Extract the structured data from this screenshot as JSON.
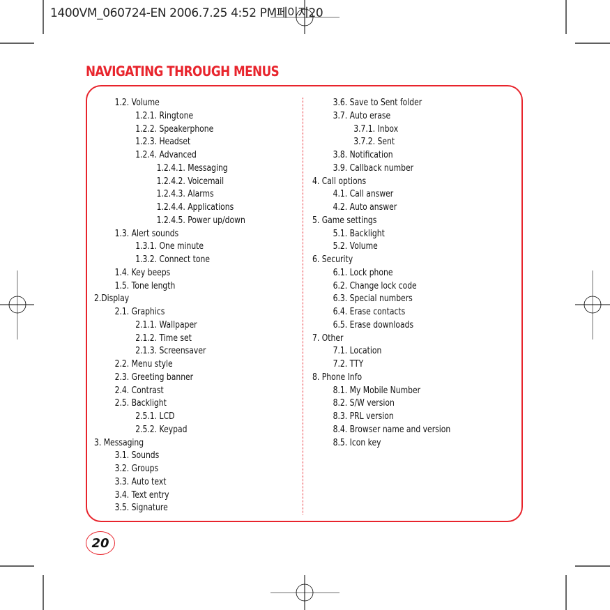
{
  "slug_line": "1400VM_060724-EN  2006.7.25 4:52 PM페이지20",
  "page_title": "NAVIGATING THROUGH MENUS",
  "page_number": "20",
  "colors": {
    "accent": "#e8242c",
    "text": "#111111",
    "registration": "#000000",
    "registration_gray": "#a0a0a0"
  },
  "left_column": [
    {
      "level": 1,
      "label": "1.2. Volume"
    },
    {
      "level": 2,
      "label": "1.2.1. Ringtone"
    },
    {
      "level": 2,
      "label": "1.2.2. Speakerphone"
    },
    {
      "level": 2,
      "label": "1.2.3. Headset"
    },
    {
      "level": 2,
      "label": "1.2.4. Advanced"
    },
    {
      "level": 3,
      "label": "1.2.4.1. Messaging"
    },
    {
      "level": 3,
      "label": "1.2.4.2. Voicemail"
    },
    {
      "level": 3,
      "label": "1.2.4.3. Alarms"
    },
    {
      "level": 3,
      "label": "1.2.4.4. Applications"
    },
    {
      "level": 3,
      "label": "1.2.4.5. Power up/down"
    },
    {
      "level": 1,
      "label": "1.3. Alert sounds"
    },
    {
      "level": 2,
      "label": "1.3.1. One minute"
    },
    {
      "level": 2,
      "label": "1.3.2. Connect tone"
    },
    {
      "level": 1,
      "label": "1.4. Key beeps"
    },
    {
      "level": 1,
      "label": "1.5. Tone length"
    },
    {
      "level": 0,
      "label": "2.Display"
    },
    {
      "level": 1,
      "label": "2.1. Graphics"
    },
    {
      "level": 2,
      "label": "2.1.1. Wallpaper"
    },
    {
      "level": 2,
      "label": "2.1.2. Time set"
    },
    {
      "level": 2,
      "label": "2.1.3. Screensaver"
    },
    {
      "level": 1,
      "label": "2.2. Menu style"
    },
    {
      "level": 1,
      "label": "2.3. Greeting banner"
    },
    {
      "level": 1,
      "label": "2.4. Contrast"
    },
    {
      "level": 1,
      "label": "2.5. Backlight"
    },
    {
      "level": 2,
      "label": "2.5.1. LCD"
    },
    {
      "level": 2,
      "label": "2.5.2. Keypad"
    },
    {
      "level": 0,
      "label": "3. Messaging"
    },
    {
      "level": 1,
      "label": "3.1. Sounds"
    },
    {
      "level": 1,
      "label": "3.2. Groups"
    },
    {
      "level": 1,
      "label": "3.3. Auto text"
    },
    {
      "level": 1,
      "label": "3.4. Text entry"
    },
    {
      "level": 1,
      "label": "3.5. Signature"
    }
  ],
  "right_column": [
    {
      "level": 1,
      "label": "3.6. Save to Sent folder"
    },
    {
      "level": 1,
      "label": "3.7. Auto erase"
    },
    {
      "level": 2,
      "label": "3.7.1. Inbox"
    },
    {
      "level": 2,
      "label": "3.7.2. Sent"
    },
    {
      "level": 1,
      "label": "3.8. Notification"
    },
    {
      "level": 1,
      "label": "3.9. Callback number"
    },
    {
      "level": 0,
      "label": "4. Call options"
    },
    {
      "level": 1,
      "label": "4.1. Call answer"
    },
    {
      "level": 1,
      "label": "4.2. Auto answer"
    },
    {
      "level": 0,
      "label": "5. Game settings"
    },
    {
      "level": 1,
      "label": "5.1. Backlight"
    },
    {
      "level": 1,
      "label": "5.2. Volume"
    },
    {
      "level": 0,
      "label": "6. Security"
    },
    {
      "level": 1,
      "label": "6.1. Lock phone"
    },
    {
      "level": 1,
      "label": "6.2. Change lock code"
    },
    {
      "level": 1,
      "label": "6.3. Special numbers"
    },
    {
      "level": 1,
      "label": "6.4. Erase contacts"
    },
    {
      "level": 1,
      "label": "6.5. Erase downloads"
    },
    {
      "level": 0,
      "label": "7. Other"
    },
    {
      "level": 1,
      "label": "7.1. Location"
    },
    {
      "level": 1,
      "label": "7.2. TTY"
    },
    {
      "level": 0,
      "label": "8. Phone Info"
    },
    {
      "level": 1,
      "label": "8.1. My Mobile Number"
    },
    {
      "level": 1,
      "label": "8.2. S/W version"
    },
    {
      "level": 1,
      "label": "8.3. PRL version"
    },
    {
      "level": 1,
      "label": "8.4. Browser name and version"
    },
    {
      "level": 1,
      "label": "8.5. Icon key"
    }
  ]
}
